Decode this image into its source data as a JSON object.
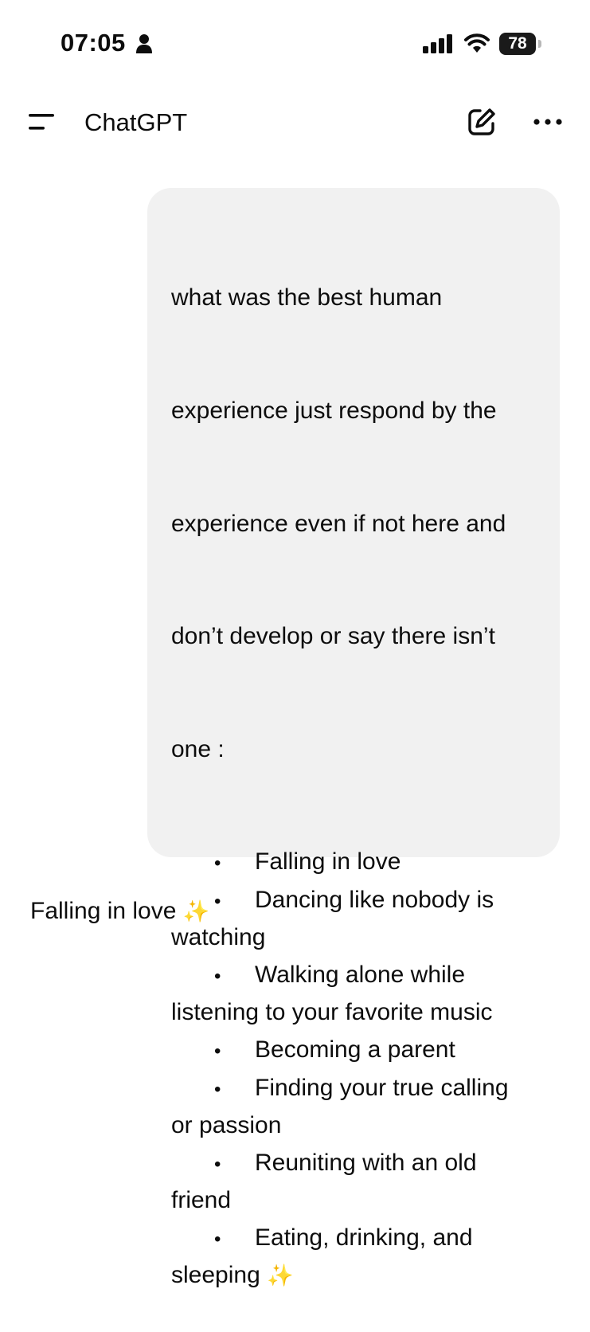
{
  "status_bar": {
    "time": "07:05",
    "battery": "78"
  },
  "header": {
    "title": "ChatGPT"
  },
  "conversation": {
    "user_message_lines": [
      "what was the best human",
      "experience just respond by the",
      "experience even if not here and",
      "don’t develop or say there isn’t",
      "one :"
    ],
    "bullet": "•",
    "list_lines": [
      {
        "bullet": true,
        "text": "Falling in love"
      },
      {
        "bullet": true,
        "text": "Dancing like nobody is"
      },
      {
        "bullet": false,
        "text": "watching"
      },
      {
        "bullet": true,
        "text": "Walking alone while"
      },
      {
        "bullet": false,
        "text": "listening to your favorite music"
      },
      {
        "bullet": true,
        "text": "Becoming a parent"
      },
      {
        "bullet": true,
        "text": "Finding your true calling"
      },
      {
        "bullet": false,
        "text": "or passion"
      },
      {
        "bullet": true,
        "text": "Reuniting with an old"
      },
      {
        "bullet": false,
        "text": "friend"
      },
      {
        "bullet": true,
        "text": "Eating, drinking, and"
      },
      {
        "bullet": false,
        "text": "sleeping"
      }
    ],
    "sparkle_emoji": "✨",
    "assistant_reply": "Falling in love"
  },
  "colors": {
    "bubble_bg": "#f1f1f1",
    "text": "#0d0d0d",
    "sparkle": "#f1c232"
  },
  "icons": [
    "person-icon",
    "signal-icon",
    "wifi-icon",
    "battery-icon",
    "menu-icon",
    "compose-icon",
    "more-icon",
    "sparkles-icon"
  ]
}
